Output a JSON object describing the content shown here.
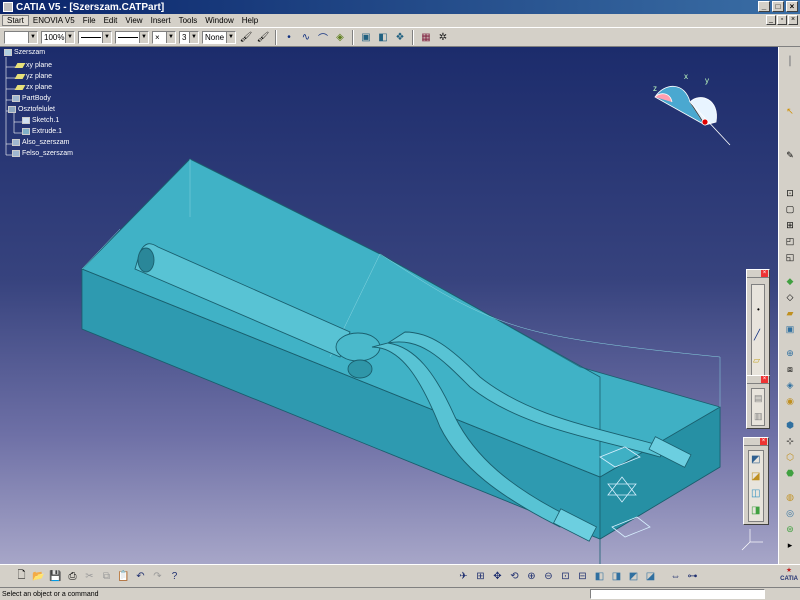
{
  "window": {
    "title": "CATIA V5 - [Szerszam.CATPart]"
  },
  "menu": [
    "Start",
    "ENOVIA V5",
    "File",
    "Edit",
    "View",
    "Insert",
    "Tools",
    "Window",
    "Help"
  ],
  "toolbar": {
    "zoom_value": "100%",
    "layer_value": "3",
    "filter_value": "None"
  },
  "tree": {
    "root": "Szerszam",
    "nodes": [
      {
        "label": "xy plane"
      },
      {
        "label": "yz plane"
      },
      {
        "label": "zx plane"
      },
      {
        "label": "PartBody"
      },
      {
        "label": "Osztofelulet"
      },
      {
        "label": "Sketch.1"
      },
      {
        "label": "Extrude.1"
      },
      {
        "label": "Also_szerszam"
      },
      {
        "label": "Felso_szerszam"
      }
    ]
  },
  "compass": {
    "x": "x",
    "y": "y",
    "z": "z"
  },
  "status": {
    "message": "Select an object or a command"
  },
  "logo": {
    "brand": "CATIA"
  },
  "colors": {
    "model": "#3fb0c4",
    "model_dark": "#2b8fa3",
    "background_top": "#1c2c6c",
    "background_bottom": "#a7a6c8"
  },
  "icons": {
    "top": [
      "color-combo",
      "zoom-combo",
      "line-type-combo",
      "line-weight-combo",
      "point-style-combo",
      "layer-combo",
      "filter-combo",
      "paint-brush-icon",
      "paint-brush2-icon",
      "point-icon",
      "curve-icon",
      "spline-icon",
      "surface-icon",
      "extrude-icon",
      "revolve-icon",
      "sweep-icon",
      "fill-icon",
      "analysis-icon"
    ],
    "bottom": [
      "new-icon",
      "open-icon",
      "save-icon",
      "print-icon",
      "cut-icon",
      "copy-icon",
      "paste-icon",
      "undo-icon",
      "redo-icon",
      "help-icon",
      "fly-icon",
      "fit-all-icon",
      "pan-icon",
      "rotate-icon",
      "zoom-in-icon",
      "zoom-out-icon",
      "normal-view-icon",
      "multi-view-icon",
      "iso-view-icon",
      "render-style-icon",
      "hide-show-icon",
      "swap-space-icon",
      "dimension-icon",
      "measure-icon"
    ]
  }
}
